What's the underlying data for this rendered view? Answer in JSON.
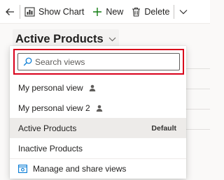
{
  "toolbar": {
    "back_icon": "arrow-left-icon",
    "show_chart_label": "Show Chart",
    "new_label": "New",
    "delete_label": "Delete",
    "more_icon": "chevron-down-icon"
  },
  "view_selector": {
    "title": "Active Products",
    "chevron_icon": "chevron-down-icon"
  },
  "dropdown": {
    "search": {
      "placeholder": "Search views",
      "value": ""
    },
    "views": [
      {
        "label": "My personal view",
        "icon": "person-icon",
        "selected": false
      },
      {
        "label": "My personal view 2",
        "icon": "person-icon",
        "selected": false
      },
      {
        "label": "Active Products",
        "badge": "Default",
        "selected": true
      },
      {
        "label": "Inactive Products",
        "selected": false
      }
    ],
    "manage_label": "Manage and share views"
  },
  "colors": {
    "accent": "#0078d4",
    "new_icon": "#107c10",
    "highlight_border": "#d9001b",
    "selected_row": "#edebe9"
  }
}
